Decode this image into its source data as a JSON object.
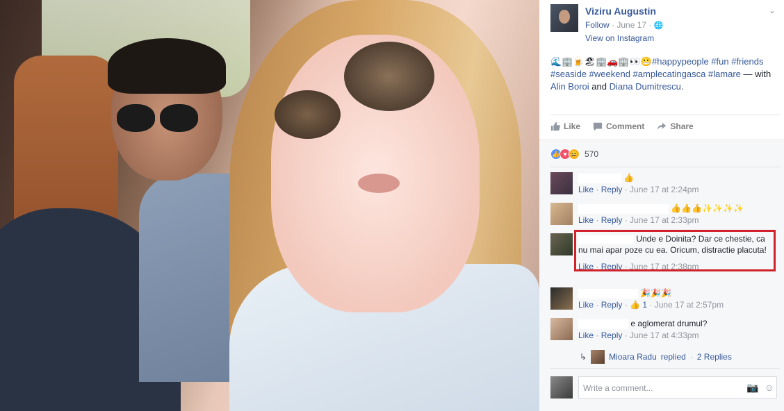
{
  "post": {
    "author": "Viziru Augustin",
    "follow_label": "Follow",
    "date": "June 17",
    "separator": "·",
    "view_on_instagram": "View on Instagram",
    "caption_emojis": "🌊🏢🍺🏖🏢🚗🏢👀😬",
    "caption_tags": "#happypeople #fun #friends #seaside #weekend #amplecatingasca #lamare",
    "caption_with": "— with",
    "tagged_1": "Alin Boroi",
    "tagged_and": "and",
    "tagged_2": "Diana Dumitrescu",
    "tagged_end": "."
  },
  "actions": {
    "like": "Like",
    "comment": "Comment",
    "share": "Share"
  },
  "reactions": {
    "count": "570"
  },
  "comments": [
    {
      "text": "👍",
      "like": "Like",
      "reply": "Reply",
      "time": "June 17 at 2:24pm"
    },
    {
      "text": "👍👍👍✨✨✨✨",
      "like": "Like",
      "reply": "Reply",
      "time": "June 17 at 2:33pm"
    },
    {
      "text": "Unde e Doinita? Dar ce chestie, ca nu mai apar poze cu ea. Oricum, distractie placuta!",
      "like": "Like",
      "reply": "Reply",
      "time": "June 17 at 2:38pm"
    },
    {
      "text": "🎉🎉🎉",
      "like": "Like",
      "reply": "Reply",
      "likes_count": "1",
      "time": "June 17 at 2:57pm"
    },
    {
      "text": "e aglomerat drumul?",
      "like": "Like",
      "reply": "Reply",
      "time": "June 17 at 4:33pm"
    }
  ],
  "replied": {
    "name": "Mioara Radu",
    "verb": "replied",
    "count": "2 Replies"
  },
  "write_comment": {
    "placeholder": "Write a comment..."
  },
  "colors": {
    "link": "#365899",
    "highlight": "#d0222a",
    "meta": "#90949c"
  }
}
